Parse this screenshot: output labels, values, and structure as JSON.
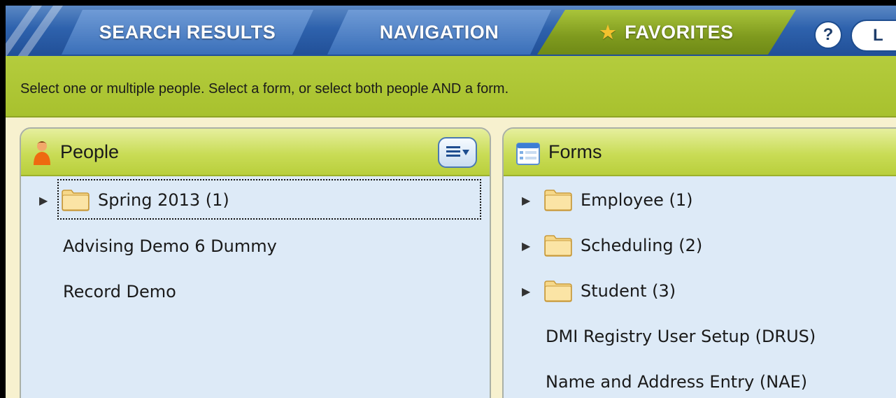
{
  "tabs": {
    "search_results": "SEARCH RESULTS",
    "navigation": "NAVIGATION",
    "favorites": "FAVORITES"
  },
  "header_buttons": {
    "help": "?",
    "login_partial": "L"
  },
  "instruction": "Select one or multiple people.  Select a form, or select both people AND a form.",
  "people": {
    "title": "People",
    "folder": {
      "label": "Spring 2013 (1)"
    },
    "items": [
      "Advising Demo 6 Dummy",
      "Record Demo"
    ]
  },
  "forms": {
    "title": "Forms",
    "folders": [
      {
        "label": "Employee (1)"
      },
      {
        "label": "Scheduling (2)"
      },
      {
        "label": "Student (3)"
      }
    ],
    "items": [
      "DMI Registry User Setup (DRUS)",
      "Name and Address Entry (NAE)"
    ]
  },
  "colors": {
    "tabbar_blue": "#2e62ad",
    "favorites_green": "#8fa928",
    "instruction_green": "#aec535",
    "panel_bg": "#ddeaf7",
    "folder_yellow": "#f6d88a"
  },
  "icons": {
    "favorites_tab": "star-icon",
    "people_header": "person-icon",
    "forms_header": "form-list-icon",
    "people_menu": "list-menu-icon",
    "expand": "triangle-right-icon",
    "folder": "folder-icon"
  }
}
